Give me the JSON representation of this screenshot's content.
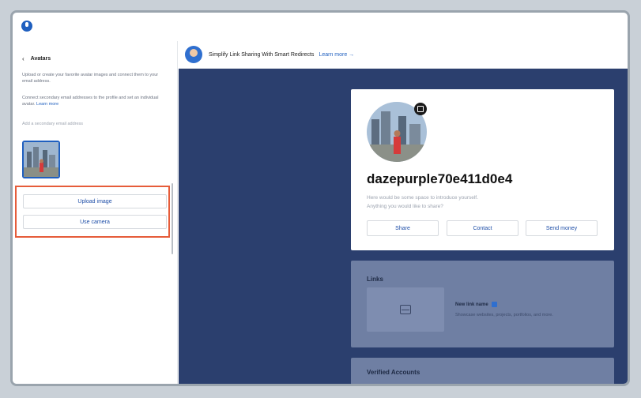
{
  "sidebar": {
    "title": "Avatars",
    "desc1": "Upload or create your favorite avatar images and connect them to your email address.",
    "desc2": "Connect secondary email addresses to the profile and set an individual avatar.",
    "learn_more": "Learn more",
    "add_email": "Add a secondary email address",
    "upload_label": "Upload image",
    "camera_label": "Use camera"
  },
  "banner": {
    "text": "Simplify Link Sharing With Smart Redirects",
    "link": "Learn more →"
  },
  "profile": {
    "username": "dazepurple70e411d0e4",
    "bio_line1": "Here would be some space to introduce yourself.",
    "bio_line2": "Anything you would like to share?",
    "share_label": "Share",
    "contact_label": "Contact",
    "send_money_label": "Send money"
  },
  "links": {
    "title": "Links",
    "new_link": "New link name",
    "sub": "Showcase websites, projects, portfolios, and more."
  },
  "verified": {
    "title": "Verified Accounts"
  },
  "colors": {
    "accent": "#1f5fbf",
    "main_bg": "#2b3f6e",
    "highlight": "#e65c3a"
  }
}
